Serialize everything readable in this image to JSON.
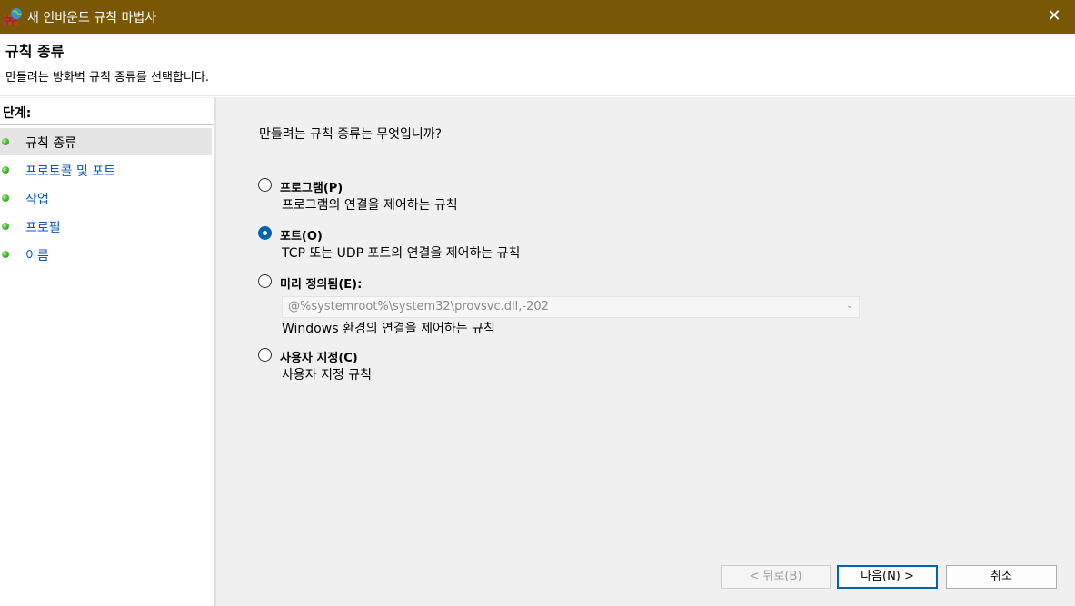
{
  "window": {
    "title": "새 인바운드 규칙 마법사",
    "app_icon": "firewall-globe-icon",
    "close_glyph": "✕"
  },
  "header": {
    "title": "규칙 종류",
    "subtitle": "만들려는 방화벽 규칙 종류를 선택합니다."
  },
  "steps": {
    "title": "단계:",
    "items": [
      {
        "label": "규칙 종류",
        "active": true
      },
      {
        "label": "프로토콜 및 포트",
        "active": false
      },
      {
        "label": "작업",
        "active": false
      },
      {
        "label": "프로필",
        "active": false
      },
      {
        "label": "이름",
        "active": false
      }
    ]
  },
  "main": {
    "question": "만들려는 규칙 종류는 무엇입니까?",
    "options": [
      {
        "label": "프로그램(P)",
        "description": "프로그램의 연결을 제어하는 규칙",
        "selected": false
      },
      {
        "label": "포트(O)",
        "description": "TCP 또는 UDP 포트의 연결을 제어하는 규칙",
        "selected": true
      },
      {
        "label": "미리 정의됨(E):",
        "description": "Windows 환경의 연결을 제어하는 규칙",
        "selected": false
      },
      {
        "label": "사용자 지정(C)",
        "description": "사용자 지정 규칙",
        "selected": false
      }
    ],
    "predefined_combo": {
      "value": "@%systemroot%\\system32\\provsvc.dll,-202",
      "enabled": false
    }
  },
  "buttons": {
    "back": "< 뒤로(B)",
    "next": "다음(N) >",
    "cancel": "취소"
  },
  "colors": {
    "titlebar": "#7a5704",
    "accent": "#0063b1",
    "step_link": "#0b57b8"
  }
}
